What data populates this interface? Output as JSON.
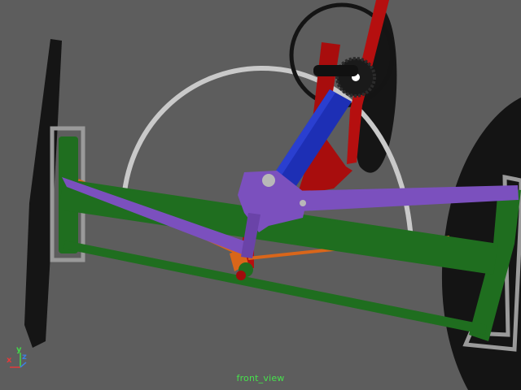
{
  "viewport": {
    "camera_name": "front_view",
    "axis_gizmo": {
      "x_label": "x",
      "y_label": "y",
      "z_label": "z"
    },
    "colors": {
      "background": "#5d5d5d",
      "tire": "#1a1a1a",
      "frame_green": "#1f6e1f",
      "steering_purple": "#7b50be",
      "column_blue": "#1f2fb0",
      "mount_red": "#b50f0f",
      "tie_rod_orange": "#d9661a",
      "arc_guide": "#c9c9c9",
      "hub_gray": "#a9a9a9"
    },
    "objects": [
      {
        "name": "left-wheel",
        "icon": "tire-icon"
      },
      {
        "name": "right-wheel",
        "icon": "tire-icon"
      },
      {
        "name": "rear-wheel",
        "icon": "tire-icon"
      },
      {
        "name": "steering-wheel",
        "icon": "steering-wheel-icon"
      },
      {
        "name": "steering-gear",
        "icon": "gear-icon"
      },
      {
        "name": "steering-column",
        "icon": "shaft-icon"
      },
      {
        "name": "lower-frame",
        "icon": "frame-icon"
      },
      {
        "name": "tie-rods",
        "icon": "rod-icon"
      },
      {
        "name": "arc-guide",
        "icon": "arc-icon"
      }
    ]
  }
}
